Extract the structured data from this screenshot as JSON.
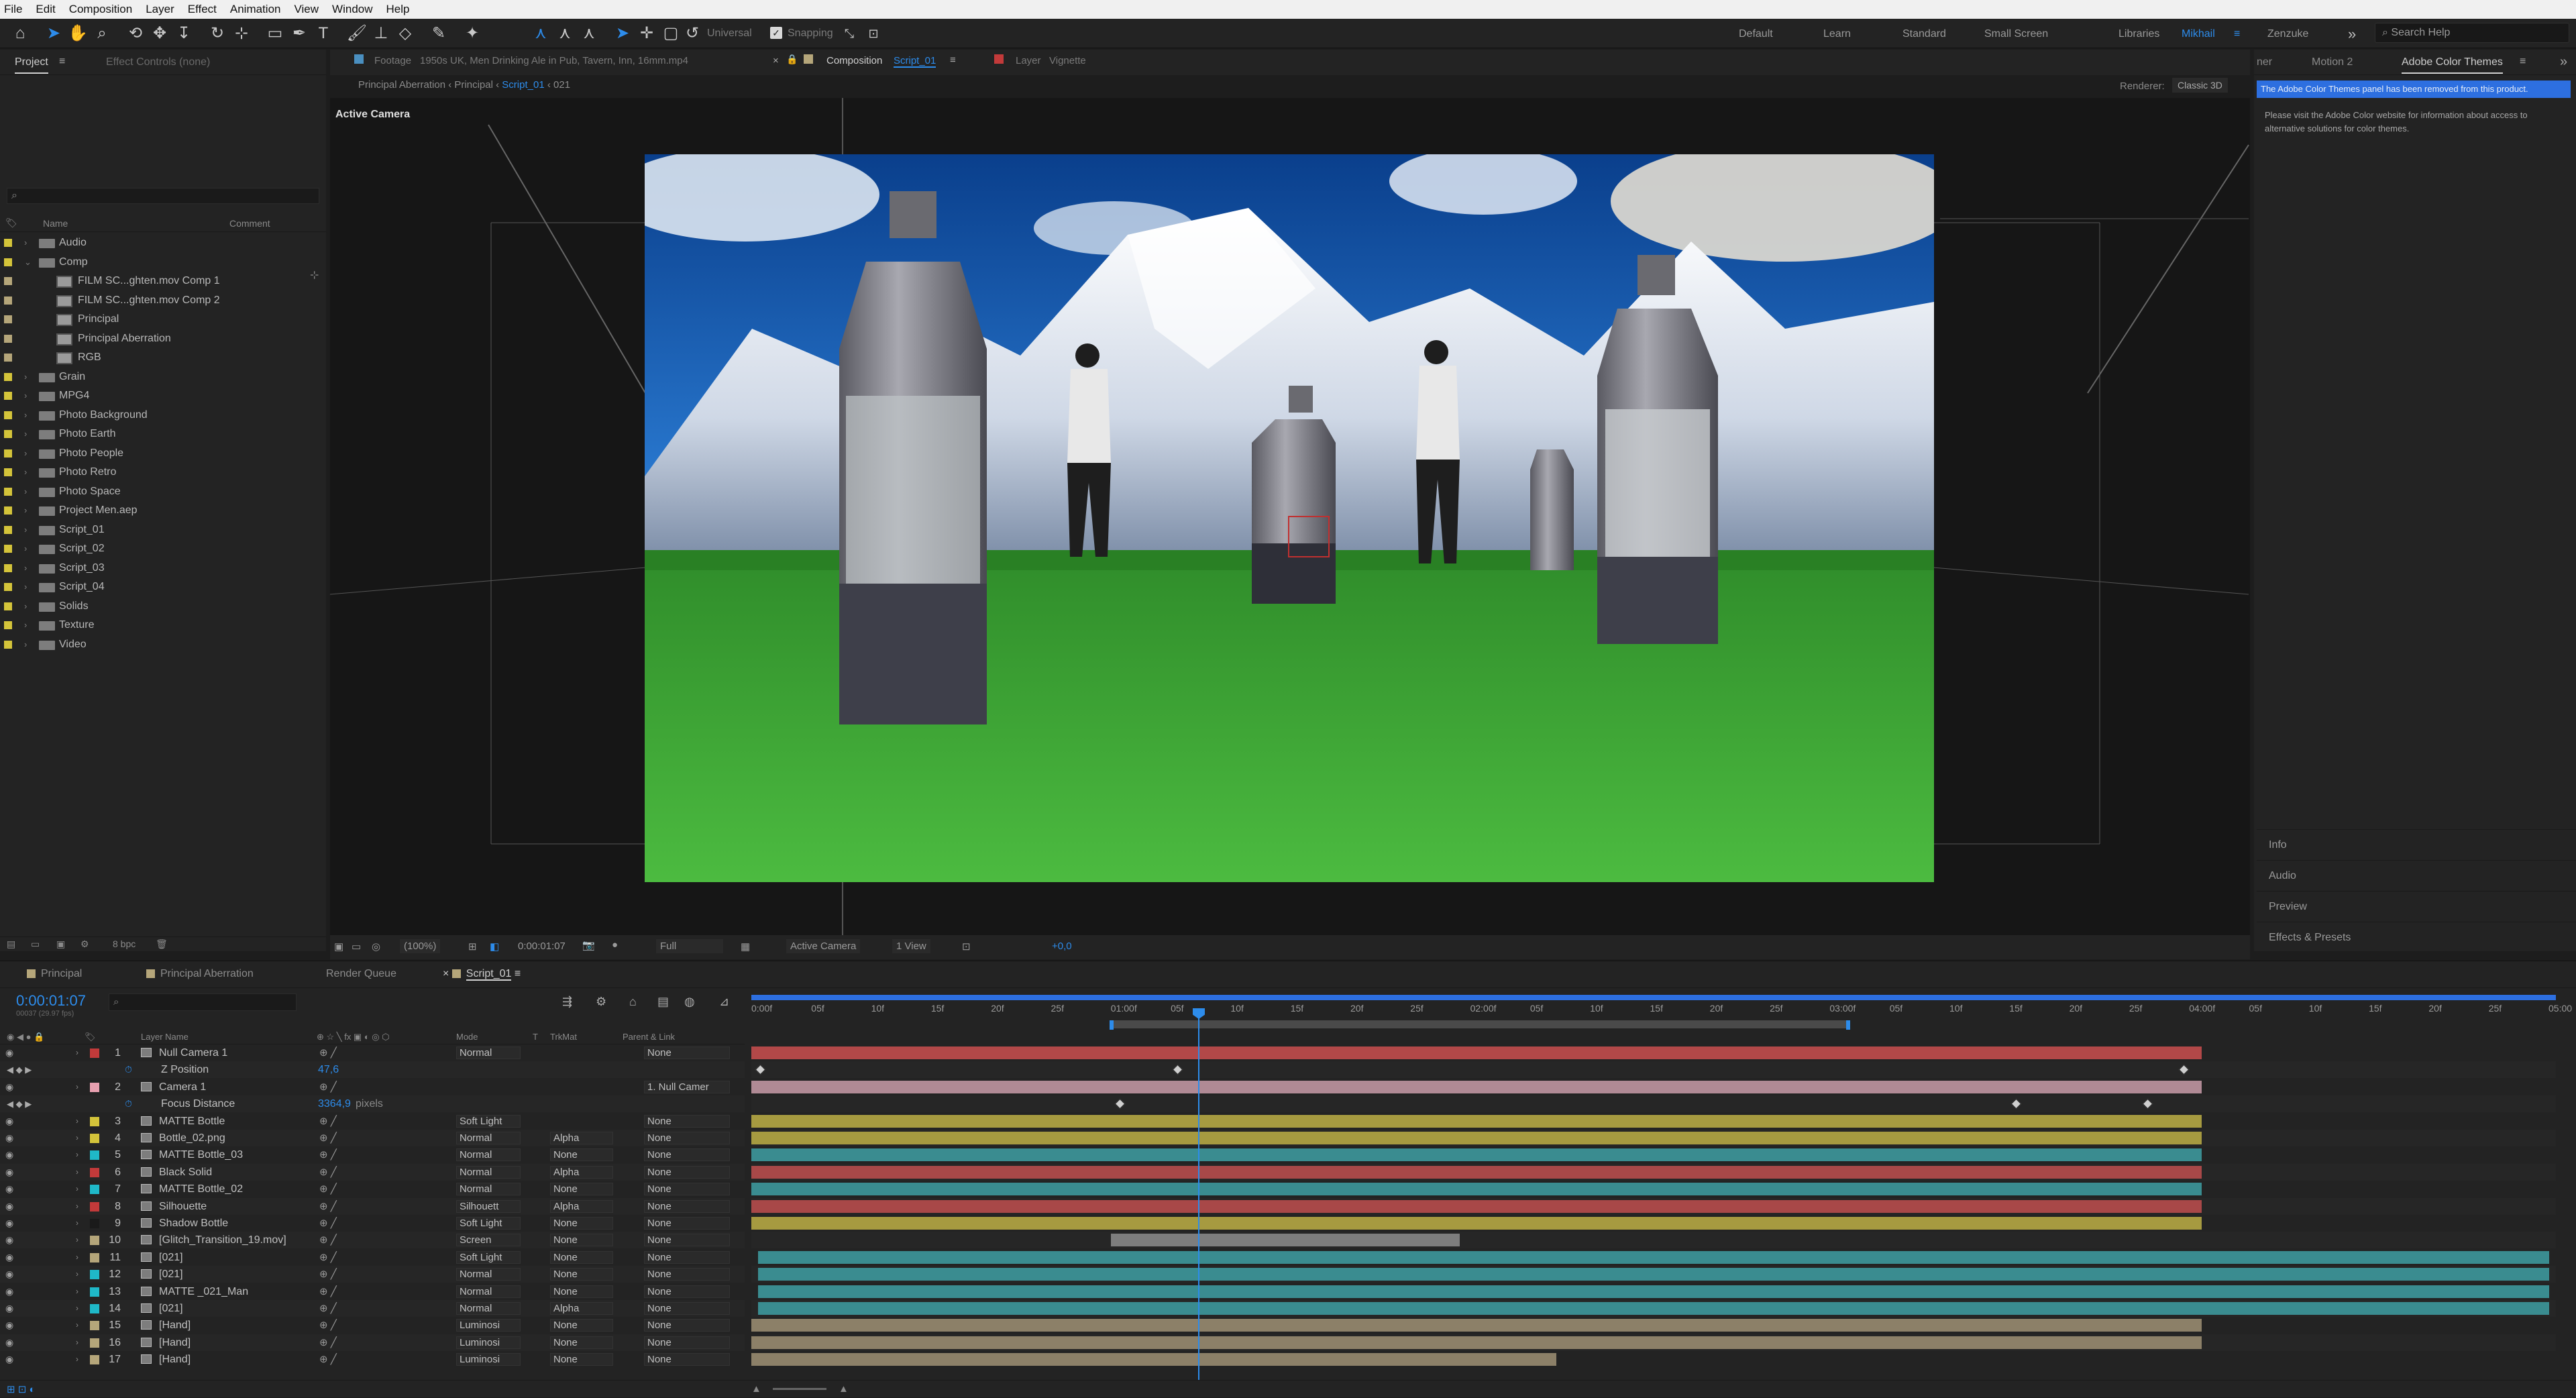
{
  "menu": [
    "File",
    "Edit",
    "Composition",
    "Layer",
    "Effect",
    "Animation",
    "View",
    "Window",
    "Help"
  ],
  "toolbar": {
    "universal": "Universal",
    "snapping": "Snapping"
  },
  "workspaces": [
    {
      "label": "Default",
      "active": false
    },
    {
      "label": "Learn",
      "active": false
    },
    {
      "label": "Standard",
      "active": false
    },
    {
      "label": "Small Screen",
      "active": false
    },
    {
      "label": "Libraries",
      "active": false
    },
    {
      "label": "Mikhail",
      "active": true
    },
    {
      "label": "Zenzuke",
      "active": false
    }
  ],
  "workspace_more": "»",
  "search_help": "Search Help",
  "project": {
    "tab_project": "Project",
    "tab_effect_controls": "Effect Controls (none)",
    "col_name": "Name",
    "col_comment": "Comment",
    "search_glyph": "⌕",
    "items": [
      {
        "name": "Audio",
        "type": "folder",
        "indent": 0,
        "color": "#d4c43a"
      },
      {
        "name": "Comp",
        "type": "folder",
        "indent": 0,
        "open": true,
        "color": "#d4c43a"
      },
      {
        "name": "FILM SC...ghten.mov Comp 1",
        "type": "comp",
        "indent": 1,
        "color": "#b5a67a"
      },
      {
        "name": "FILM SC...ghten.mov Comp 2",
        "type": "comp",
        "indent": 1,
        "color": "#b5a67a"
      },
      {
        "name": "Principal",
        "type": "comp",
        "indent": 1,
        "color": "#b5a67a"
      },
      {
        "name": "Principal Aberration",
        "type": "comp",
        "indent": 1,
        "color": "#b5a67a"
      },
      {
        "name": "RGB",
        "type": "comp",
        "indent": 1,
        "color": "#b5a67a"
      },
      {
        "name": "Grain",
        "type": "folder",
        "indent": 0,
        "color": "#d4c43a"
      },
      {
        "name": "MPG4",
        "type": "folder",
        "indent": 0,
        "color": "#d4c43a"
      },
      {
        "name": "Photo Background",
        "type": "folder",
        "indent": 0,
        "color": "#d4c43a"
      },
      {
        "name": "Photo Earth",
        "type": "folder",
        "indent": 0,
        "color": "#d4c43a"
      },
      {
        "name": "Photo People",
        "type": "folder",
        "indent": 0,
        "color": "#d4c43a"
      },
      {
        "name": "Photo Retro",
        "type": "folder",
        "indent": 0,
        "color": "#d4c43a"
      },
      {
        "name": "Photo Space",
        "type": "folder",
        "indent": 0,
        "color": "#d4c43a"
      },
      {
        "name": "Project Men.aep",
        "type": "folder",
        "indent": 0,
        "color": "#d4c43a"
      },
      {
        "name": "Script_01",
        "type": "folder",
        "indent": 0,
        "color": "#d4c43a"
      },
      {
        "name": "Script_02",
        "type": "folder",
        "indent": 0,
        "color": "#d4c43a"
      },
      {
        "name": "Script_03",
        "type": "folder",
        "indent": 0,
        "color": "#d4c43a"
      },
      {
        "name": "Script_04",
        "type": "folder",
        "indent": 0,
        "color": "#d4c43a"
      },
      {
        "name": "Solids",
        "type": "folder",
        "indent": 0,
        "color": "#d4c43a"
      },
      {
        "name": "Texture",
        "type": "folder",
        "indent": 0,
        "color": "#d4c43a"
      },
      {
        "name": "Video",
        "type": "folder",
        "indent": 0,
        "color": "#d4c43a"
      }
    ],
    "bpc": "8 bpc"
  },
  "viewer": {
    "tab_footage_prefix": "Footage",
    "tab_footage": "1950s UK, Men Drinking Ale in Pub, Tavern, Inn, 16mm.mp4",
    "tab_comp_prefix": "Composition",
    "tab_comp": "Script_01",
    "tab_layer_prefix": "Layer",
    "tab_layer": "Vignette",
    "breadcrumbs": [
      "Principal Aberration",
      "Principal",
      "Script_01",
      "021"
    ],
    "renderer_label": "Renderer:",
    "renderer": "Classic 3D",
    "active_camera": "Active Camera",
    "zoom": "(100%)",
    "time": "0:00:01:07",
    "resolution": "Full",
    "view": "Active Camera",
    "views": "1 View",
    "exposure": "+0,0"
  },
  "right_panel": {
    "tab_partial": "ner",
    "tab_motion": "Motion 2",
    "tab_color": "Adobe Color Themes",
    "banner": "The Adobe Color Themes panel has been removed from this product.",
    "message": "Please visit the Adobe Color website for information about access to alternative solutions for color themes.",
    "sections": [
      "Info",
      "Audio",
      "Preview",
      "Effects & Presets"
    ]
  },
  "timeline": {
    "tabs": [
      {
        "label": "Principal",
        "color": "#b5a67a",
        "active": false
      },
      {
        "label": "Principal Aberration",
        "color": "#b5a67a",
        "active": false
      },
      {
        "label": "Render Queue",
        "color": "",
        "active": false
      },
      {
        "label": "Script_01",
        "color": "#b5a67a",
        "active": true
      }
    ],
    "timecode": "0:00:01:07",
    "frames": "00037 (29.97 fps)",
    "col_layer_name": "Layer Name",
    "col_mode": "Mode",
    "col_t": "T",
    "col_trkmat": "TrkMat",
    "col_parent": "Parent & Link",
    "ruler": [
      "0:00f",
      "05f",
      "10f",
      "15f",
      "20f",
      "25f",
      "01:00f",
      "05f",
      "10f",
      "15f",
      "20f",
      "25f",
      "02:00f",
      "05f",
      "10f",
      "15f",
      "20f",
      "25f",
      "03:00f",
      "05f",
      "10f",
      "15f",
      "20f",
      "25f",
      "04:00f",
      "05f",
      "10f",
      "15f",
      "20f",
      "25f",
      "05:00"
    ],
    "layers": [
      {
        "num": "1",
        "name": "Null Camera 1",
        "color": "#c23a3a",
        "mode": "Normal",
        "trk": "",
        "parent": "None",
        "bar": "#b24848"
      },
      {
        "num": "",
        "name": "Z Position",
        "sub": true,
        "value": "47,6",
        "bar": ""
      },
      {
        "num": "2",
        "name": "Camera 1",
        "color": "#e8a0b0",
        "mode": "",
        "trk": "",
        "parent": "1. Null Camer",
        "bar": "#b08a95"
      },
      {
        "num": "",
        "name": "Focus Distance",
        "sub": true,
        "value": "3364,9",
        "unit": "pixels",
        "bar": ""
      },
      {
        "num": "3",
        "name": "MATTE Bottle",
        "color": "#d4c43a",
        "mode": "Soft Light",
        "trk": "",
        "parent": "None",
        "bar": "#a69a40"
      },
      {
        "num": "4",
        "name": "Bottle_02.png",
        "color": "#d4c43a",
        "mode": "Normal",
        "trk": "Alpha",
        "parent": "None",
        "bar": "#a69a40"
      },
      {
        "num": "5",
        "name": "MATTE Bottle_03",
        "color": "#1fb8c8",
        "mode": "Normal",
        "trk": "None",
        "parent": "None",
        "bar": "#3a8c90"
      },
      {
        "num": "6",
        "name": "Black Solid",
        "color": "#c23a3a",
        "mode": "Normal",
        "trk": "Alpha",
        "parent": "None",
        "bar": "#a84848"
      },
      {
        "num": "7",
        "name": "MATTE Bottle_02",
        "color": "#1fb8c8",
        "mode": "Normal",
        "trk": "None",
        "parent": "None",
        "bar": "#3a8c90"
      },
      {
        "num": "8",
        "name": "Silhouette",
        "color": "#c23a3a",
        "mode": "Silhouett",
        "trk": "Alpha",
        "parent": "None",
        "bar": "#a84848"
      },
      {
        "num": "9",
        "name": "Shadow Bottle",
        "color": "#1a1a1a",
        "mode": "Soft Light",
        "trk": "None",
        "parent": "None",
        "bar": "#a69a40"
      },
      {
        "num": "10",
        "name": "[Glitch_Transition_19.mov]",
        "color": "#b5a67a",
        "mode": "Screen",
        "trk": "None",
        "parent": "None",
        "bar": "#7d7d7d"
      },
      {
        "num": "11",
        "name": "[021]",
        "color": "#b5a67a",
        "mode": "Soft Light",
        "trk": "None",
        "parent": "None",
        "bar": "#3a8c90"
      },
      {
        "num": "12",
        "name": "[021]",
        "color": "#1fb8c8",
        "mode": "Normal",
        "trk": "None",
        "parent": "None",
        "bar": "#3a8c90"
      },
      {
        "num": "13",
        "name": "MATTE _021_Man",
        "color": "#1fb8c8",
        "mode": "Normal",
        "trk": "None",
        "parent": "None",
        "bar": "#3a8c90"
      },
      {
        "num": "14",
        "name": "[021]",
        "color": "#1fb8c8",
        "mode": "Normal",
        "trk": "Alpha",
        "parent": "None",
        "bar": "#3a8c90"
      },
      {
        "num": "15",
        "name": "[Hand]",
        "color": "#b5a67a",
        "mode": "Luminosi",
        "trk": "None",
        "parent": "None",
        "bar": "#8c8068"
      },
      {
        "num": "16",
        "name": "[Hand]",
        "color": "#b5a67a",
        "mode": "Luminosi",
        "trk": "None",
        "parent": "None",
        "bar": "#8c8068"
      },
      {
        "num": "17",
        "name": "[Hand]",
        "color": "#b5a67a",
        "mode": "Luminosi",
        "trk": "None",
        "parent": "None",
        "bar": "#8c8068"
      }
    ]
  },
  "colors": {
    "accent": "#2d8ceb",
    "panel": "#232323",
    "bg": "#1d1d1d"
  }
}
